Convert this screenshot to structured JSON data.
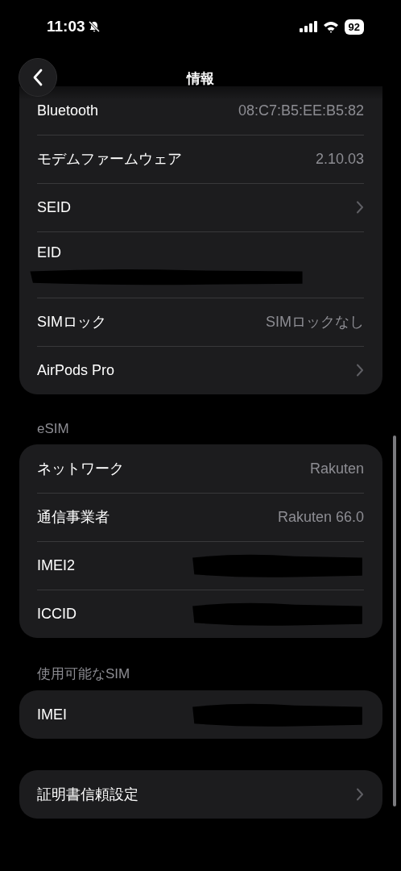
{
  "status_bar": {
    "time": "11:03",
    "silent": true,
    "battery": "92"
  },
  "nav": {
    "title": "情報"
  },
  "sections": [
    {
      "rows": [
        {
          "kind": "value",
          "label": "Bluetooth",
          "value": "08:C7:B5:EE:B5:82"
        },
        {
          "kind": "value",
          "label": "モデムファームウェア",
          "value": "2.10.03"
        },
        {
          "kind": "chevron",
          "label": "SEID"
        },
        {
          "kind": "redacted_below",
          "label": "EID"
        },
        {
          "kind": "value",
          "label": "SIMロック",
          "value": "SIMロックなし"
        },
        {
          "kind": "chevron",
          "label": "AirPods Pro"
        }
      ]
    },
    {
      "header": "eSIM",
      "rows": [
        {
          "kind": "value",
          "label": "ネットワーク",
          "value": "Rakuten"
        },
        {
          "kind": "value",
          "label": "通信事業者",
          "value": "Rakuten 66.0"
        },
        {
          "kind": "redacted_value",
          "label": "IMEI2"
        },
        {
          "kind": "redacted_value",
          "label": "ICCID"
        }
      ]
    },
    {
      "header": "使用可能なSIM",
      "rows": [
        {
          "kind": "redacted_value",
          "label": "IMEI"
        }
      ]
    },
    {
      "rows": [
        {
          "kind": "chevron",
          "label": "証明書信頼設定"
        }
      ]
    }
  ]
}
